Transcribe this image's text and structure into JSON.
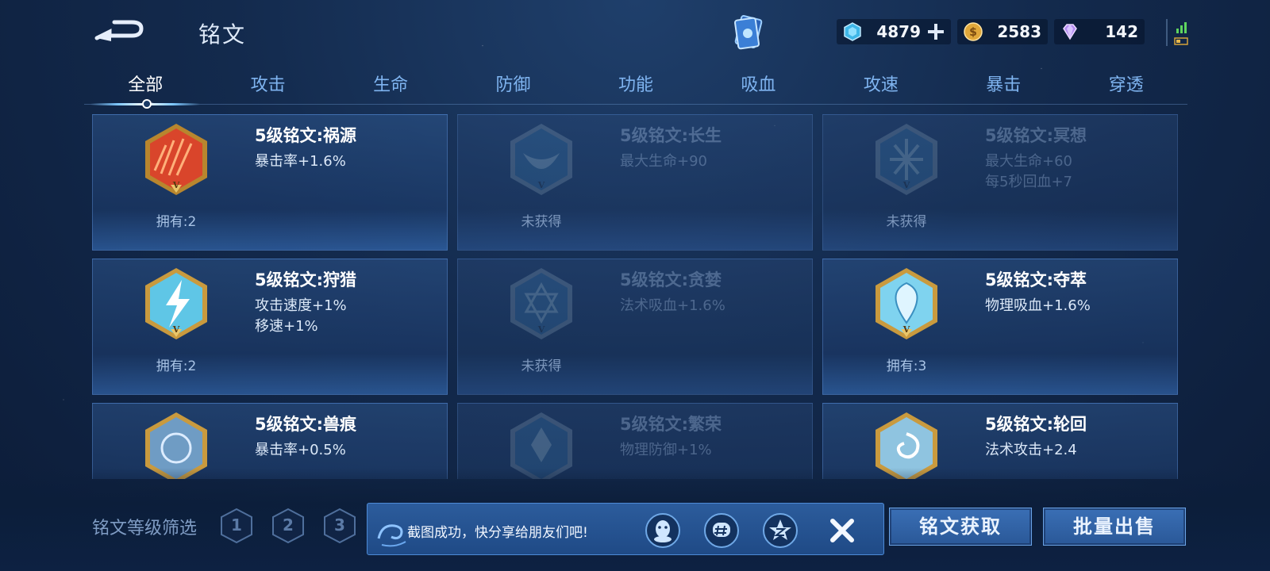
{
  "header": {
    "title": "铭文",
    "back_icon": "back-arrow-icon",
    "currencies": [
      {
        "name": "点券",
        "icon": "coupon-icon",
        "value": "4879"
      },
      {
        "name": "金币",
        "icon": "gold-coin-icon",
        "value": "2583"
      },
      {
        "name": "钻石",
        "icon": "diamond-icon",
        "value": "142"
      }
    ]
  },
  "tabs": [
    "全部",
    "攻击",
    "生命",
    "防御",
    "功能",
    "吸血",
    "攻速",
    "暴击",
    "穿透"
  ],
  "active_tab": "全部",
  "runes": [
    {
      "name": "5级铭文:祸源",
      "stats": [
        "暴击率+1.6%"
      ],
      "owned": "拥有:2",
      "locked": false,
      "color": "#d9452b"
    },
    {
      "name": "5级铭文:长生",
      "stats": [
        "最大生命+90"
      ],
      "owned": "未获得",
      "locked": true,
      "color": "#3a7ab0"
    },
    {
      "name": "5级铭文:冥想",
      "stats": [
        "最大生命+60",
        "每5秒回血+7"
      ],
      "owned": "未获得",
      "locked": true,
      "color": "#3a7ab0"
    },
    {
      "name": "5级铭文:狩猎",
      "stats": [
        "攻击速度+1%",
        "移速+1%"
      ],
      "owned": "拥有:2",
      "locked": false,
      "color": "#5fc6e6"
    },
    {
      "name": "5级铭文:贪婪",
      "stats": [
        "法术吸血+1.6%"
      ],
      "owned": "未获得",
      "locked": true,
      "color": "#3a7ab0"
    },
    {
      "name": "5级铭文:夺萃",
      "stats": [
        "物理吸血+1.6%"
      ],
      "owned": "拥有:3",
      "locked": false,
      "color": "#7fd3ef"
    },
    {
      "name": "5级铭文:兽痕",
      "stats": [
        "暴击率+0.5%"
      ],
      "owned": "",
      "locked": false,
      "color": "#6f9cc4"
    },
    {
      "name": "5级铭文:繁荣",
      "stats": [
        "物理防御+1%"
      ],
      "owned": "",
      "locked": true,
      "color": "#3a7ab0"
    },
    {
      "name": "5级铭文:轮回",
      "stats": [
        "法术攻击+2.4"
      ],
      "owned": "",
      "locked": false,
      "color": "#8fc4e0"
    }
  ],
  "filter": {
    "label": "铭文等级筛选",
    "levels": [
      "1",
      "2",
      "3"
    ]
  },
  "share_toast": {
    "text": "截图成功，快分享给朋友们吧!",
    "icons": [
      "qq-icon",
      "wechat-moments-icon",
      "qzone-icon"
    ]
  },
  "buttons": {
    "acquire": "铭文获取",
    "bulk_sell": "批量出售"
  }
}
